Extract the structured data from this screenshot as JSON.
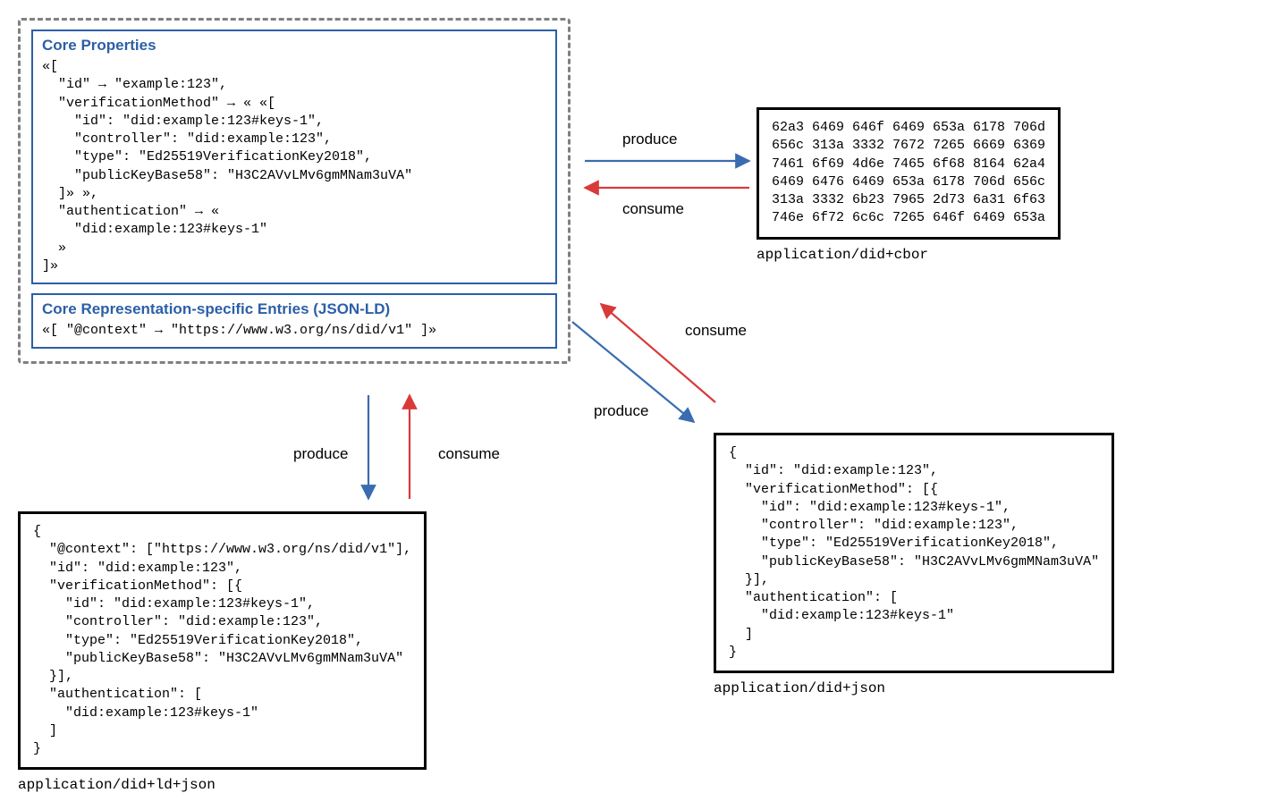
{
  "dataModel": {
    "corePropsTitle": "Core Properties",
    "corePropsCode": "«[\n  \"id\" → \"example:123\",\n  \"verificationMethod\" → « «[\n    \"id\": \"did:example:123#keys-1\",\n    \"controller\": \"did:example:123\",\n    \"type\": \"Ed25519VerificationKey2018\",\n    \"publicKeyBase58\": \"H3C2AVvLMv6gmMNam3uVA\"\n  ]» »,\n  \"authentication\" → «\n    \"did:example:123#keys-1\"\n  »\n]»",
    "repSpecificTitle": "Core Representation-specific Entries (JSON-LD)",
    "repSpecificCode": "«[ \"@context\" → \"https://www.w3.org/ns/did/v1\" ]»"
  },
  "cbor": {
    "hex": "62a3 6469 646f 6469 653a 6178 706d\n656c 313a 3332 7672 7265 6669 6369\n7461 6f69 4d6e 7465 6f68 8164 62a4\n6469 6476 6469 653a 6178 706d 656c\n313a 3332 6b23 7965 2d73 6a31 6f63\n746e 6f72 6c6c 7265 646f 6469 653a",
    "mime": "application/did+cbor"
  },
  "json": {
    "code": "{\n  \"id\": \"did:example:123\",\n  \"verificationMethod\": [{\n    \"id\": \"did:example:123#keys-1\",\n    \"controller\": \"did:example:123\",\n    \"type\": \"Ed25519VerificationKey2018\",\n    \"publicKeyBase58\": \"H3C2AVvLMv6gmMNam3uVA\"\n  }],\n  \"authentication\": [\n    \"did:example:123#keys-1\"\n  ]\n}",
    "mime": "application/did+json"
  },
  "jsonld": {
    "code": "{\n  \"@context\": [\"https://www.w3.org/ns/did/v1\"],\n  \"id\": \"did:example:123\",\n  \"verificationMethod\": [{\n    \"id\": \"did:example:123#keys-1\",\n    \"controller\": \"did:example:123\",\n    \"type\": \"Ed25519VerificationKey2018\",\n    \"publicKeyBase58\": \"H3C2AVvLMv6gmMNam3uVA\"\n  }],\n  \"authentication\": [\n    \"did:example:123#keys-1\"\n  ]\n}",
    "mime": "application/did+ld+json"
  },
  "labels": {
    "produce": "produce",
    "consume": "consume"
  },
  "colors": {
    "dashedBorder": "#808080",
    "blueBorder": "#2b5fa8",
    "produceArrow": "#3a6cb0",
    "consumeArrow": "#d83a3a"
  }
}
